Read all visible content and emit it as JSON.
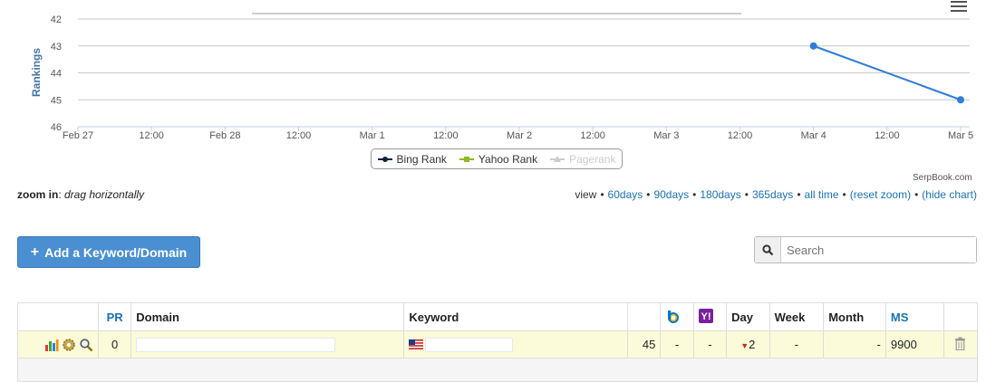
{
  "chart_data": {
    "type": "line",
    "ylabel": "Rankings",
    "y_reversed": true,
    "ylim": [
      42,
      46
    ],
    "yticks": [
      42,
      43,
      44,
      45,
      46
    ],
    "xticks": [
      "Feb 27",
      "12:00",
      "Feb 28",
      "12:00",
      "Mar 1",
      "12:00",
      "Mar 2",
      "12:00",
      "Mar 3",
      "12:00",
      "Mar 4",
      "12:00",
      "Mar 5"
    ],
    "series": [
      {
        "name": "Bing Rank",
        "color": "#0d233a",
        "points": []
      },
      {
        "name": "Yahoo Rank",
        "color": "#8bbc21",
        "points": [
          {
            "x": "Mar 4",
            "y": 43
          },
          {
            "x": "Mar 5",
            "y": 45
          }
        ],
        "line_color": "#2f7ed8"
      },
      {
        "name": "Pagerank",
        "color": "#cccccc",
        "points": [],
        "disabled": true
      }
    ],
    "grid": true,
    "legend_position": "bottom-center",
    "credits": "SerpBook.com"
  },
  "zoom": {
    "label": "zoom in",
    "hint": "drag horizontally"
  },
  "view": {
    "label": "view",
    "links": [
      "60days",
      "90days",
      "180days",
      "365days",
      "all time",
      "(reset zoom)",
      "(hide chart)"
    ]
  },
  "toolbar": {
    "add_label": "Add a Keyword/Domain"
  },
  "search": {
    "placeholder": "Search"
  },
  "table": {
    "headers": {
      "pr": "PR",
      "domain": "Domain",
      "keyword": "Keyword",
      "day": "Day",
      "week": "Week",
      "month": "Month",
      "ms": "MS"
    },
    "rows": [
      {
        "pr": "0",
        "domain": "",
        "keyword": "",
        "google": "45",
        "bing": "-",
        "yahoo": "-",
        "day": "2",
        "week": "-",
        "month": "-",
        "ms": "9900"
      }
    ]
  },
  "colors": {
    "accent": "#1a72b4",
    "button": "#4a8fd2",
    "row_highlight": "#fbfbd9",
    "line": "#2f7ed8"
  }
}
